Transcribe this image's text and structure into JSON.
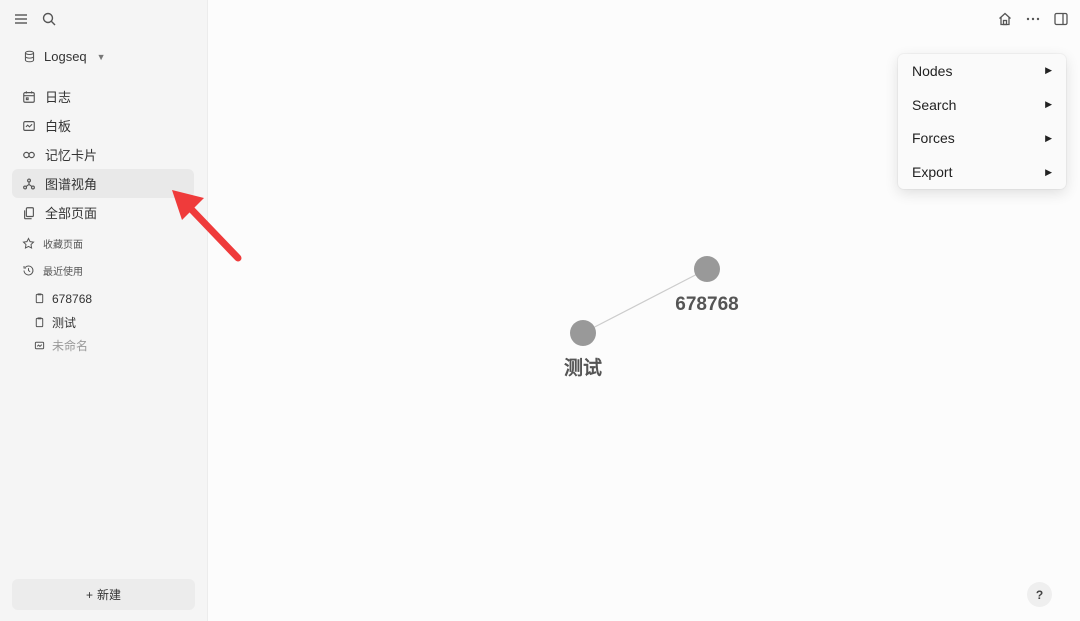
{
  "sidebar": {
    "graph_name": "Logseq",
    "nav": [
      {
        "label": "日志",
        "icon": "calendar-icon"
      },
      {
        "label": "白板",
        "icon": "whiteboard-icon"
      },
      {
        "label": "记忆卡片",
        "icon": "flashcards-icon"
      },
      {
        "label": "图谱视角",
        "icon": "graph-icon"
      },
      {
        "label": "全部页面",
        "icon": "pages-icon"
      }
    ],
    "favorites_label": "收藏页面",
    "recent_label": "最近使用",
    "recent": [
      {
        "label": "678768",
        "icon": "page-icon"
      },
      {
        "label": "测试",
        "icon": "page-icon"
      },
      {
        "label": "未命名",
        "icon": "whiteboard-icon"
      }
    ],
    "new_button": "新建",
    "new_button_prefix": "+"
  },
  "menu": {
    "items": [
      {
        "label": "Nodes"
      },
      {
        "label": "Search"
      },
      {
        "label": "Forces"
      },
      {
        "label": "Export"
      }
    ]
  },
  "graph": {
    "nodes": [
      {
        "label": "678768"
      },
      {
        "label": "测试"
      }
    ],
    "node_color": "#999999",
    "edge_color": "#cccccc"
  },
  "help": {
    "label": "?"
  }
}
